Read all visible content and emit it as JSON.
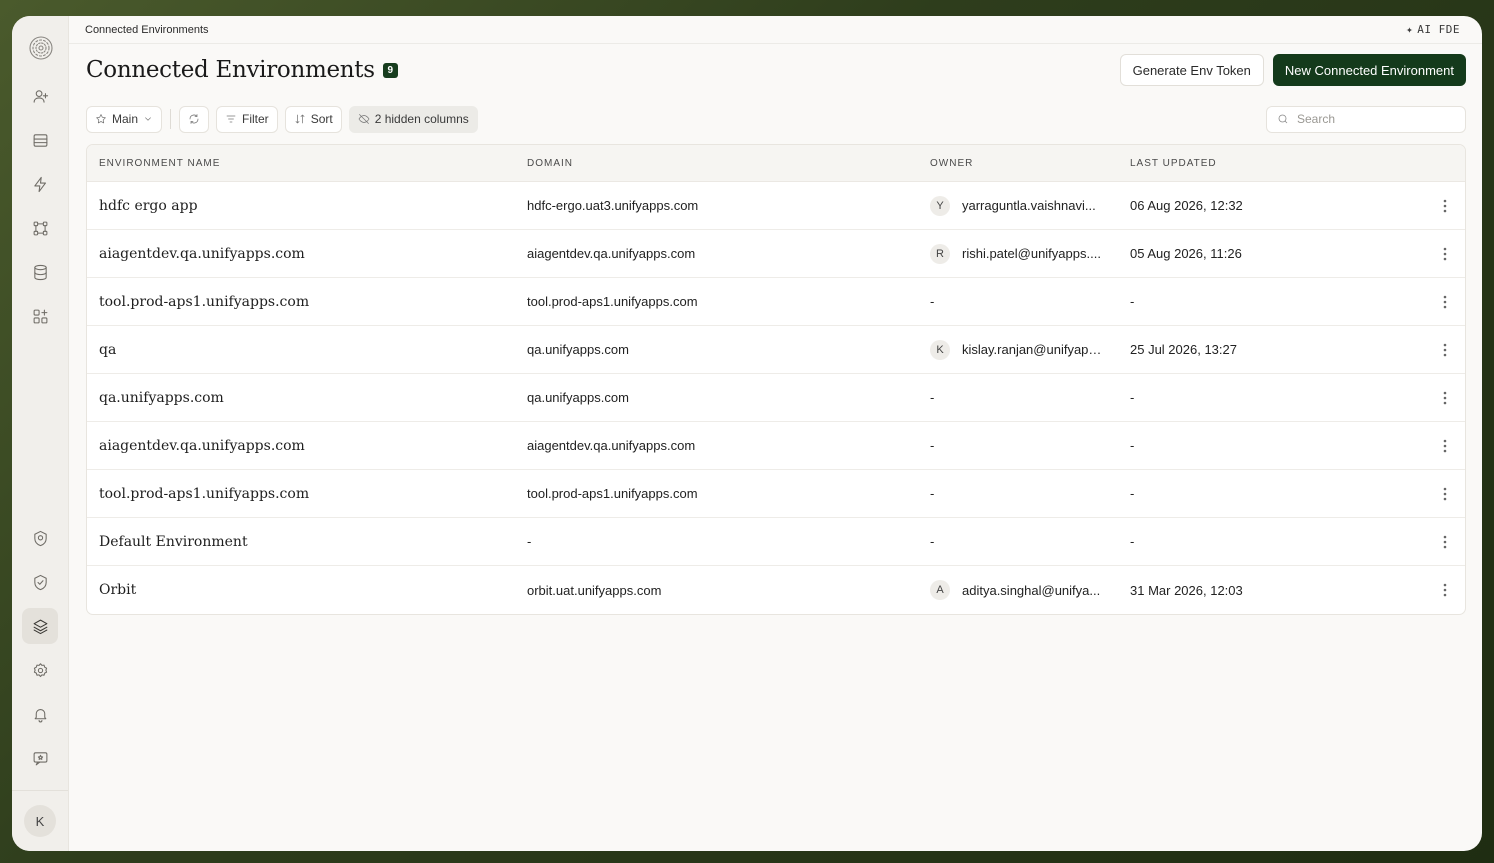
{
  "topbar": {
    "breadcrumb": "Connected Environments",
    "ai_label": "AI FDE"
  },
  "header": {
    "title": "Connected Environments",
    "count": "9",
    "generate_token_label": "Generate Env Token",
    "new_env_label": "New Connected Environment"
  },
  "toolbar": {
    "view_label": "Main",
    "filter_label": "Filter",
    "sort_label": "Sort",
    "hidden_columns_label": "2 hidden columns",
    "search_placeholder": "Search"
  },
  "sidebar": {
    "user_initial": "K",
    "icons": [
      "spiral-logo-icon",
      "user-plus-icon",
      "inbox-icon",
      "lightning-icon",
      "workflow-icon",
      "database-icon",
      "apps-icon",
      "shield-badge-icon",
      "shield-check-icon",
      "layers-icon",
      "settings-icon",
      "bell-icon",
      "feedback-icon"
    ]
  },
  "table": {
    "columns": {
      "name": "Environment Name",
      "domain": "Domain",
      "owner": "Owner",
      "updated": "Last Updated"
    },
    "rows": [
      {
        "name": "hdfc ergo app",
        "domain": "hdfc-ergo.uat3.unifyapps.com",
        "owner_initial": "Y",
        "owner": "yarraguntla.vaishnavi...",
        "updated": "06 Aug 2026, 12:32"
      },
      {
        "name": "aiagentdev.qa.unifyapps.com",
        "domain": "aiagentdev.qa.unifyapps.com",
        "owner_initial": "R",
        "owner": "rishi.patel@unifyapps....",
        "updated": "05 Aug 2026, 11:26"
      },
      {
        "name": "tool.prod-aps1.unifyapps.com",
        "domain": "tool.prod-aps1.unifyapps.com",
        "owner_initial": "",
        "owner": "-",
        "updated": "-"
      },
      {
        "name": "qa",
        "domain": "qa.unifyapps.com",
        "owner_initial": "K",
        "owner": "kislay.ranjan@unifyapp...",
        "updated": "25 Jul 2026, 13:27"
      },
      {
        "name": "qa.unifyapps.com",
        "domain": "qa.unifyapps.com",
        "owner_initial": "",
        "owner": "-",
        "updated": "-"
      },
      {
        "name": "aiagentdev.qa.unifyapps.com",
        "domain": "aiagentdev.qa.unifyapps.com",
        "owner_initial": "",
        "owner": "-",
        "updated": "-"
      },
      {
        "name": "tool.prod-aps1.unifyapps.com",
        "domain": "tool.prod-aps1.unifyapps.com",
        "owner_initial": "",
        "owner": "-",
        "updated": "-"
      },
      {
        "name": "Default Environment",
        "domain": "-",
        "owner_initial": "",
        "owner": "-",
        "updated": "-"
      },
      {
        "name": "Orbit",
        "domain": "orbit.uat.unifyapps.com",
        "owner_initial": "A",
        "owner": "aditya.singhal@unifya...",
        "updated": "31 Mar 2026, 12:03"
      }
    ]
  },
  "colors": {
    "primary": "#143a1b",
    "badge": "#173d1e",
    "sidebar_bg": "#f1efeb",
    "page_bg": "#faf9f7"
  }
}
